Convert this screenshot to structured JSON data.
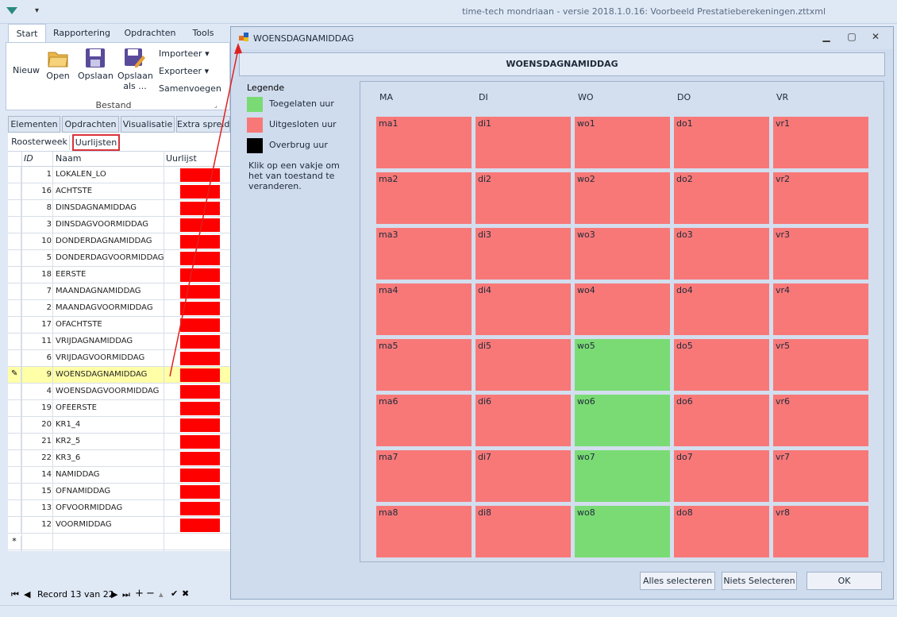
{
  "app": {
    "title": "time-tech mondriaan - versie 2018.1.0.16: Voorbeeld Prestatieberekeningen.zttxml"
  },
  "ribbon": {
    "tabs": [
      "Start",
      "Rapportering",
      "Opdrachten",
      "Tools"
    ],
    "buttons": {
      "new": "Nieuw",
      "open": "Open",
      "save": "Opslaan",
      "save_as_1": "Opslaan",
      "save_as_2": "als ...",
      "import": "Importeer",
      "export": "Exporteer",
      "merge": "Samenvoegen"
    },
    "group": "Bestand"
  },
  "element_tabs": [
    "Elementen",
    "Opdrachten",
    "Visualisatie",
    "Extra spreidin"
  ],
  "sub_tabs": [
    "Roosterweek",
    "Uurlijsten"
  ],
  "grid": {
    "columns": [
      "ID",
      "Naam",
      "Uurlijst"
    ],
    "rows": [
      {
        "id": "1",
        "name": "LOKALEN_LO"
      },
      {
        "id": "16",
        "name": "ACHTSTE"
      },
      {
        "id": "8",
        "name": "DINSDAGNAMIDDAG"
      },
      {
        "id": "3",
        "name": "DINSDAGVOORMIDDAG"
      },
      {
        "id": "10",
        "name": "DONDERDAGNAMIDDAG"
      },
      {
        "id": "5",
        "name": "DONDERDAGVOORMIDDAG"
      },
      {
        "id": "18",
        "name": "EERSTE"
      },
      {
        "id": "7",
        "name": "MAANDAGNAMIDDAG"
      },
      {
        "id": "2",
        "name": "MAANDAGVOORMIDDAG"
      },
      {
        "id": "17",
        "name": "OFACHTSTE"
      },
      {
        "id": "11",
        "name": "VRIJDAGNAMIDDAG"
      },
      {
        "id": "6",
        "name": "VRIJDAGVOORMIDDAG"
      },
      {
        "id": "9",
        "name": "WOENSDAGNAMIDDAG"
      },
      {
        "id": "4",
        "name": "WOENSDAGVOORMIDDAG"
      },
      {
        "id": "19",
        "name": "OFEERSTE"
      },
      {
        "id": "20",
        "name": "KR1_4"
      },
      {
        "id": "21",
        "name": "KR2_5"
      },
      {
        "id": "22",
        "name": "KR3_6"
      },
      {
        "id": "14",
        "name": "NAMIDDAG"
      },
      {
        "id": "15",
        "name": "OFNAMIDDAG"
      },
      {
        "id": "13",
        "name": "OFVOORMIDDAG"
      },
      {
        "id": "12",
        "name": "VOORMIDDAG"
      }
    ],
    "new_row_marker": "*"
  },
  "navigator": {
    "record_text": "Record 13 van 22"
  },
  "dialog": {
    "title": "WOENSDAGNAMIDDAG",
    "header": "WOENSDAGNAMIDDAG",
    "legend": {
      "title": "Legende",
      "allowed": "Toegelaten uur",
      "excluded": "Uitgesloten uur",
      "bridge": "Overbrug uur",
      "note": "Klik op een vakje om het van toestand te veranderen."
    },
    "days": [
      "MA",
      "DI",
      "WO",
      "DO",
      "VR"
    ],
    "prefixes": [
      "ma",
      "di",
      "wo",
      "do",
      "vr"
    ],
    "allowed_cells": [
      "wo5",
      "wo6",
      "wo7",
      "wo8"
    ],
    "periods": 8,
    "buttons": {
      "select_all": "Alles selecteren",
      "select_none": "Niets Selecteren",
      "ok": "OK"
    }
  },
  "colors": {
    "allowed": "#7adb74",
    "excluded": "#f87878",
    "bridge": "#000000",
    "bar_red": "#ff0000",
    "bar_green": "#008000"
  }
}
